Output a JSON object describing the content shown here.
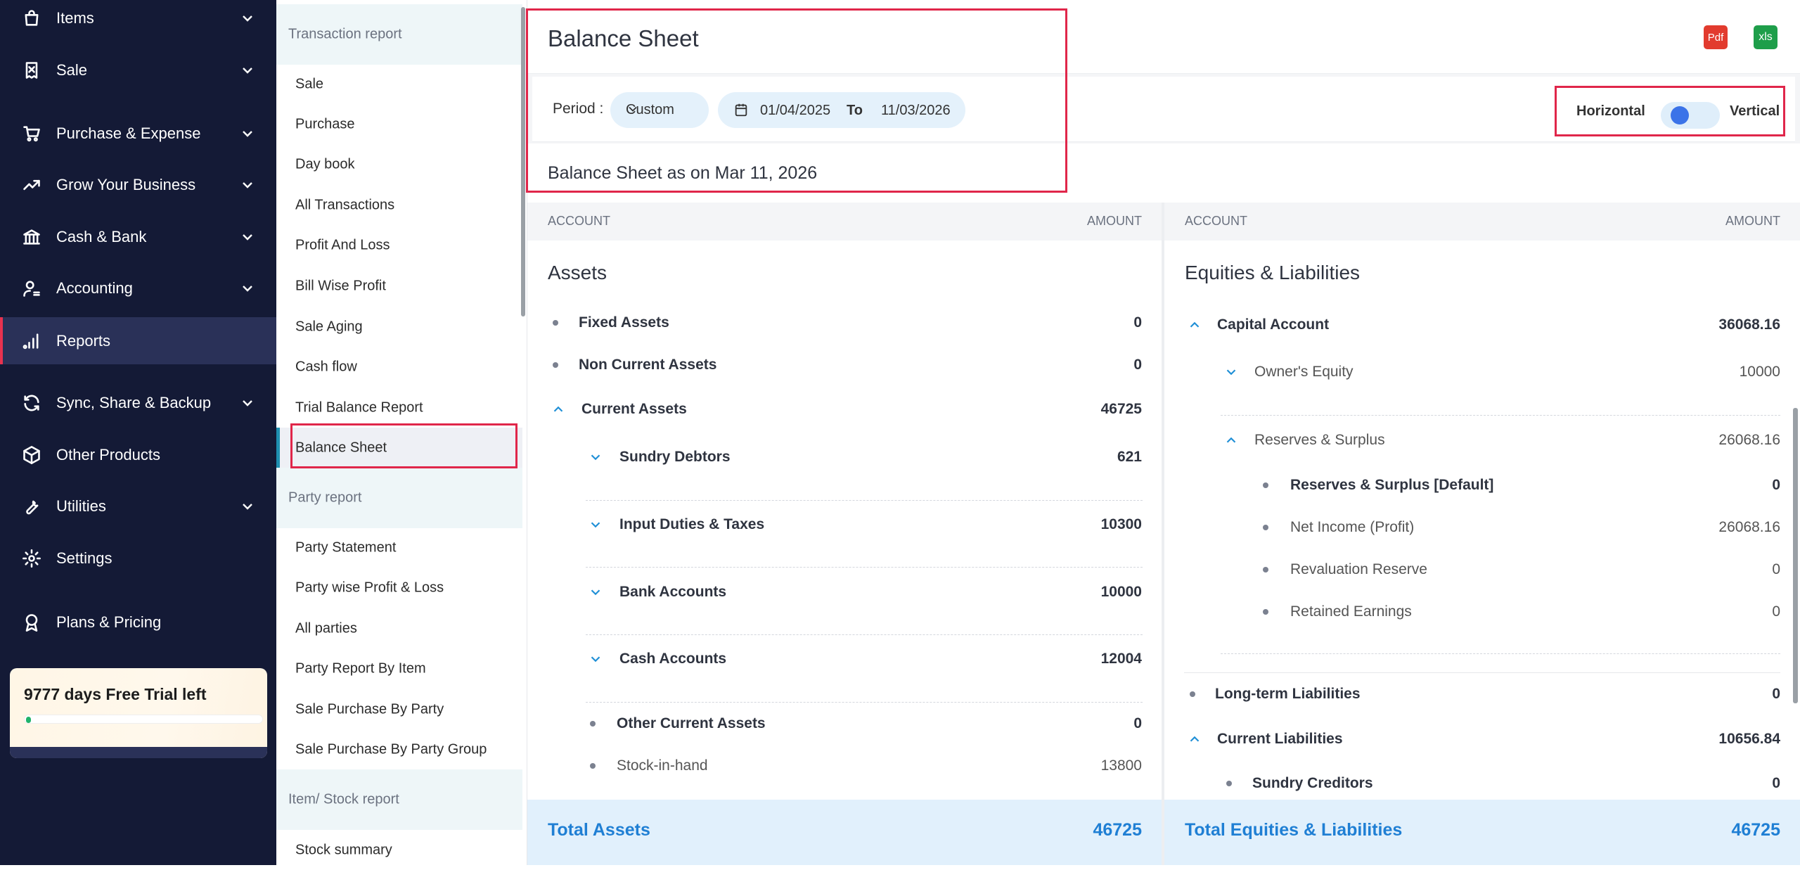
{
  "sidebar": {
    "items": [
      {
        "label": "Items",
        "icon": "bag-icon"
      },
      {
        "label": "Sale",
        "icon": "receipt-icon"
      },
      {
        "label": "Purchase & Expense",
        "icon": "cart-icon"
      },
      {
        "label": "Grow Your Business",
        "icon": "trend-up-icon"
      },
      {
        "label": "Cash & Bank",
        "icon": "bank-icon"
      },
      {
        "label": "Accounting",
        "icon": "user-accounting-icon"
      },
      {
        "label": "Reports",
        "icon": "bar-chart-icon"
      },
      {
        "label": "Sync, Share & Backup",
        "icon": "sync-icon"
      },
      {
        "label": "Other Products",
        "icon": "box-icon"
      },
      {
        "label": "Utilities",
        "icon": "wrench-icon"
      },
      {
        "label": "Settings",
        "icon": "gear-icon"
      },
      {
        "label": "Plans & Pricing",
        "icon": "badge-icon"
      }
    ],
    "trial": {
      "text": "9777 days Free Trial left",
      "progress": 0.02
    }
  },
  "report_panel": {
    "sections": [
      {
        "title": "Transaction report",
        "items": [
          "Sale",
          "Purchase",
          "Day book",
          "All Transactions",
          "Profit And Loss",
          "Bill Wise Profit",
          "Sale Aging",
          "Cash flow",
          "Trial Balance Report",
          "Balance Sheet"
        ]
      },
      {
        "title": "Party report",
        "items": [
          "Party Statement",
          "Party wise Profit & Loss",
          "All parties",
          "Party Report By Item",
          "Sale Purchase By Party",
          "Sale Purchase By Party Group"
        ]
      },
      {
        "title": "Item/ Stock report",
        "items": [
          "Stock summary"
        ]
      }
    ],
    "active_item": "Balance Sheet"
  },
  "header": {
    "title": "Balance Sheet",
    "pdf_label": "Pdf",
    "xls_label": "xls"
  },
  "filters": {
    "period_label": "Period :",
    "period_value": "Custom",
    "date_from": "01/04/2025",
    "to_label": "To",
    "date_to": "11/03/2026",
    "layout_left": "Horizontal",
    "layout_right": "Vertical",
    "layout_selected": "Horizontal"
  },
  "as_on": "Balance Sheet as on Mar 11, 2026",
  "assets": {
    "header_account": "ACCOUNT",
    "header_amount": "AMOUNT",
    "title": "Assets",
    "rows": [
      {
        "label": "Fixed Assets",
        "value": "0"
      },
      {
        "label": "Non Current Assets",
        "value": "0"
      },
      {
        "label": "Current Assets",
        "value": "46725"
      },
      {
        "label": "Sundry Debtors",
        "value": "621"
      },
      {
        "label": "Input Duties & Taxes",
        "value": "10300"
      },
      {
        "label": "Bank Accounts",
        "value": "10000"
      },
      {
        "label": "Cash Accounts",
        "value": "12004"
      },
      {
        "label": "Other Current Assets",
        "value": "0"
      },
      {
        "label": "Stock-in-hand",
        "value": "13800"
      }
    ],
    "total_label": "Total Assets",
    "total_value": "46725"
  },
  "liabilities": {
    "header_account": "ACCOUNT",
    "header_amount": "AMOUNT",
    "title": "Equities & Liabilities",
    "rows": [
      {
        "label": "Capital Account",
        "value": "36068.16"
      },
      {
        "label": "Owner's Equity",
        "value": "10000"
      },
      {
        "label": "Reserves & Surplus",
        "value": "26068.16"
      },
      {
        "label": "Reserves & Surplus [Default]",
        "value": "0"
      },
      {
        "label": "Net Income (Profit)",
        "value": "26068.16"
      },
      {
        "label": "Revaluation Reserve",
        "value": "0"
      },
      {
        "label": "Retained Earnings",
        "value": "0"
      },
      {
        "label": "Long-term Liabilities",
        "value": "0"
      },
      {
        "label": "Current Liabilities",
        "value": "10656.84"
      },
      {
        "label": "Sundry Creditors",
        "value": "0"
      }
    ],
    "total_label": "Total Equities & Liabilities",
    "total_value": "46725"
  },
  "colors": {
    "sidebar_bg": "#141a36",
    "accent_blue": "#1f7fd4",
    "highlight_red": "#e0264a",
    "pdf_red": "#e23b2e",
    "xls_green": "#1e9e4a"
  }
}
